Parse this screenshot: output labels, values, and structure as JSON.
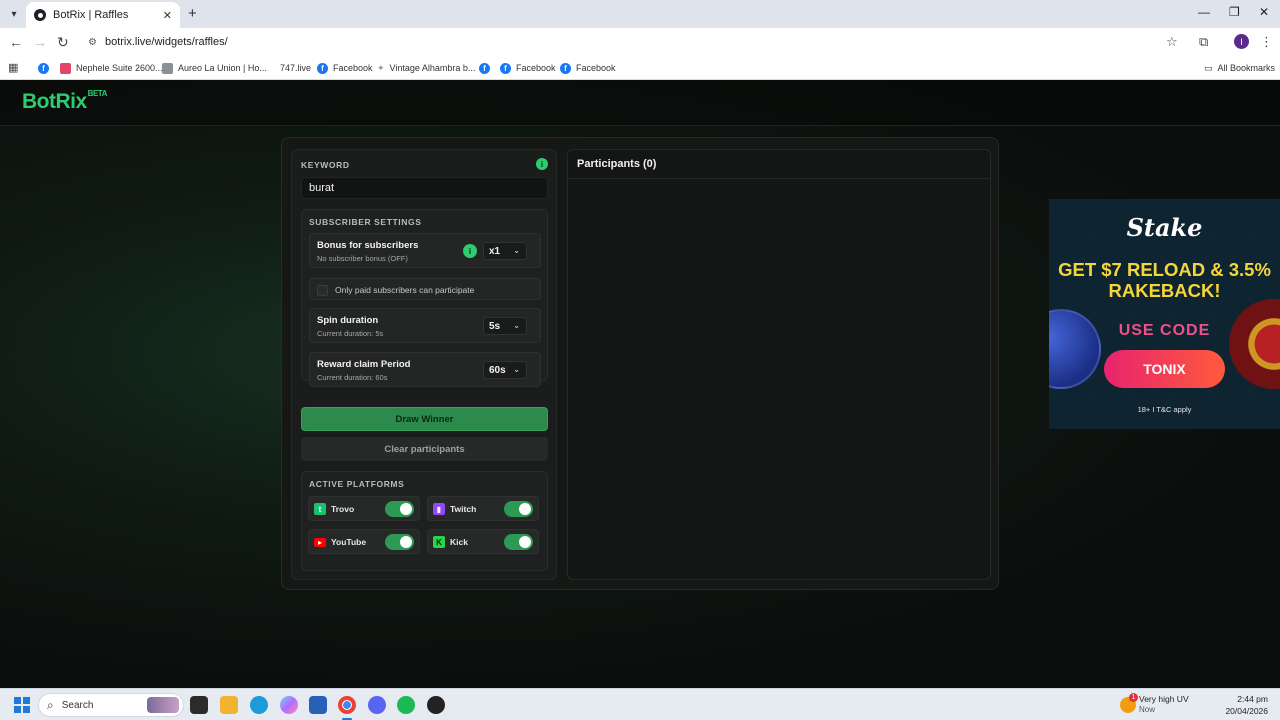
{
  "browser": {
    "tab_title": "BotRix | Raffles",
    "url": "botrix.live/widgets/raffles/",
    "bookmarks": [
      "Nephele Suite 2600...",
      "Aureo La Union | Ho...",
      "747.live",
      "Facebook",
      "Vintage Alhambra b...",
      "Facebook",
      "Facebook"
    ],
    "all_bookmarks": "All Bookmarks",
    "profile_initial": "I"
  },
  "app": {
    "logo": "BotRix",
    "logo_badge": "BETA",
    "accent_color": "#2ecc71"
  },
  "raffle": {
    "keyword_label": "KEYWORD",
    "keyword_value": "burat",
    "subscriber_settings_label": "SUBSCRIBER SETTINGS",
    "bonus_title": "Bonus for subscribers",
    "bonus_sub": "No subscriber bonus (OFF)",
    "bonus_value": "x1",
    "paid_only_label": "Only paid subscribers can participate",
    "spin_title": "Spin duration",
    "spin_sub": "Current duration: 5s",
    "spin_value": "5s",
    "reward_title": "Reward claim Period",
    "reward_sub": "Current duration: 60s",
    "reward_value": "60s",
    "draw_button": "Draw Winner",
    "clear_button": "Clear participants",
    "active_platforms_label": "ACTIVE PLATFORMS",
    "platforms": [
      {
        "name": "Trovo",
        "enabled": true,
        "icon": "trovo-icon"
      },
      {
        "name": "Twitch",
        "enabled": true,
        "icon": "twitch-icon"
      },
      {
        "name": "YouTube",
        "enabled": true,
        "icon": "youtube-icon"
      },
      {
        "name": "Kick",
        "enabled": true,
        "icon": "kick-icon"
      }
    ],
    "participants_title": "Participants (0)"
  },
  "ad": {
    "brand": "Stake",
    "headline": "GET $7 RELOAD & 3.5% RAKEBACK!",
    "use_code": "USE CODE",
    "code": "TONIX",
    "terms": "18+ I T&C apply"
  },
  "taskbar": {
    "search_placeholder": "Search",
    "weather_title": "Very high UV",
    "weather_sub": "Now",
    "weather_badge": "1",
    "time": "2:44 pm",
    "date": "20/04/2026"
  }
}
